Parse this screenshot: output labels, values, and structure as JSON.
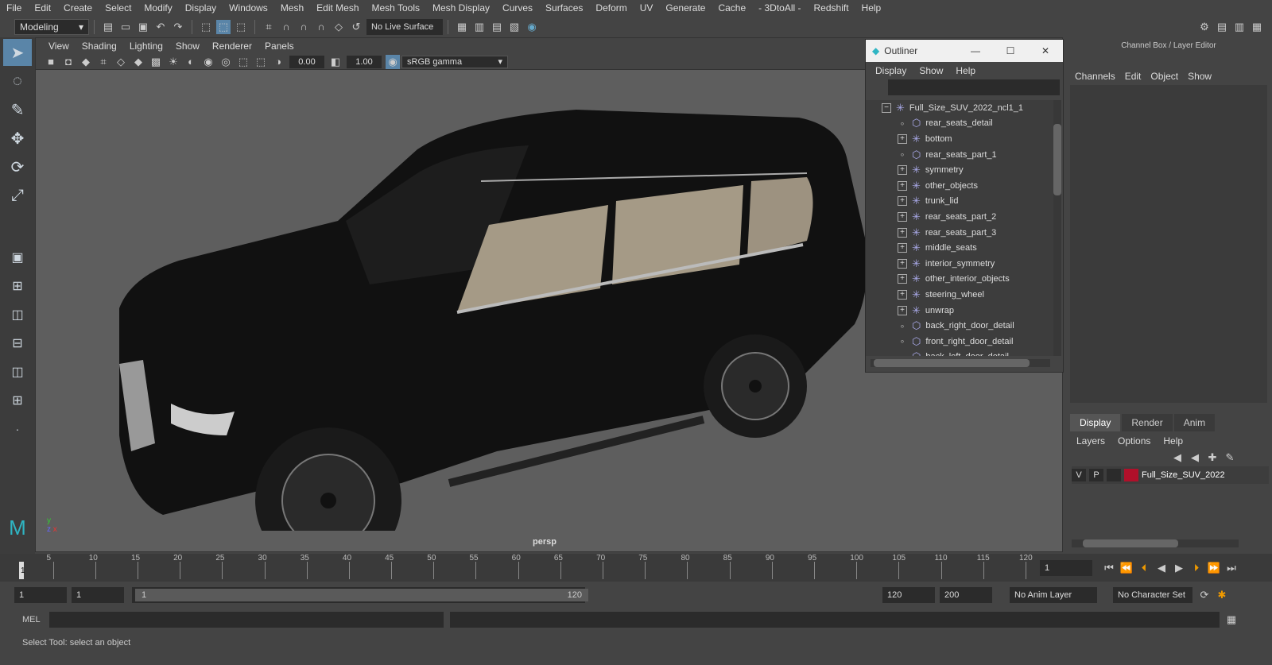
{
  "menubar": {
    "items": [
      "File",
      "Edit",
      "Create",
      "Select",
      "Modify",
      "Display",
      "Windows",
      "Mesh",
      "Edit Mesh",
      "Mesh Tools",
      "Mesh Display",
      "Curves",
      "Surfaces",
      "Deform",
      "UV",
      "Generate",
      "Cache",
      "- 3DtoAll -",
      "Redshift",
      "Help"
    ]
  },
  "shelf": {
    "mode": "Modeling",
    "live_surface": "No Live Surface"
  },
  "viewport": {
    "menu": [
      "View",
      "Shading",
      "Lighting",
      "Show",
      "Renderer",
      "Panels"
    ],
    "exposure": "0.00",
    "gamma": "1.00",
    "colorspace": "sRGB gamma",
    "camera": "persp"
  },
  "outliner": {
    "title": "Outliner",
    "menu": [
      "Display",
      "Show",
      "Help"
    ],
    "items": [
      {
        "name": "Full_Size_SUV_2022_ncl1_1",
        "kind": "root"
      },
      {
        "name": "rear_seats_detail",
        "kind": "mesh"
      },
      {
        "name": "bottom",
        "kind": "group"
      },
      {
        "name": "rear_seats_part_1",
        "kind": "mesh"
      },
      {
        "name": "symmetry",
        "kind": "group"
      },
      {
        "name": "other_objects",
        "kind": "group"
      },
      {
        "name": "trunk_lid",
        "kind": "group"
      },
      {
        "name": "rear_seats_part_2",
        "kind": "group"
      },
      {
        "name": "rear_seats_part_3",
        "kind": "group"
      },
      {
        "name": "middle_seats",
        "kind": "group"
      },
      {
        "name": "interior_symmetry",
        "kind": "group"
      },
      {
        "name": "other_interior_objects",
        "kind": "group"
      },
      {
        "name": "steering_wheel",
        "kind": "group"
      },
      {
        "name": "unwrap",
        "kind": "group"
      },
      {
        "name": "back_right_door_detail",
        "kind": "mesh"
      },
      {
        "name": "front_right_door_detail",
        "kind": "mesh"
      },
      {
        "name": "back_left_door_detail",
        "kind": "mesh"
      }
    ]
  },
  "channelbox": {
    "title": "Channel Box / Layer Editor",
    "menu": [
      "Channels",
      "Edit",
      "Object",
      "Show"
    ],
    "tabs": [
      "Display",
      "Render",
      "Anim"
    ],
    "layer_menu": [
      "Layers",
      "Options",
      "Help"
    ],
    "layer": {
      "v": "V",
      "p": "P",
      "name": "Full_Size_SUV_2022",
      "color": "#b0102a"
    }
  },
  "timeline": {
    "ticks": [
      "1",
      "5",
      "10",
      "15",
      "20",
      "25",
      "30",
      "35",
      "40",
      "45",
      "50",
      "55",
      "60",
      "65",
      "70",
      "75",
      "80",
      "85",
      "90",
      "95",
      "100",
      "105",
      "110",
      "115",
      "120"
    ],
    "current": "1"
  },
  "range": {
    "start": "1",
    "start2": "1",
    "slider_start": "1",
    "slider_end": "120",
    "end": "120",
    "end2": "200",
    "anim_layer": "No Anim Layer",
    "char_set": "No Character Set"
  },
  "mel": {
    "label": "MEL"
  },
  "status": {
    "text": "Select Tool: select an object"
  }
}
